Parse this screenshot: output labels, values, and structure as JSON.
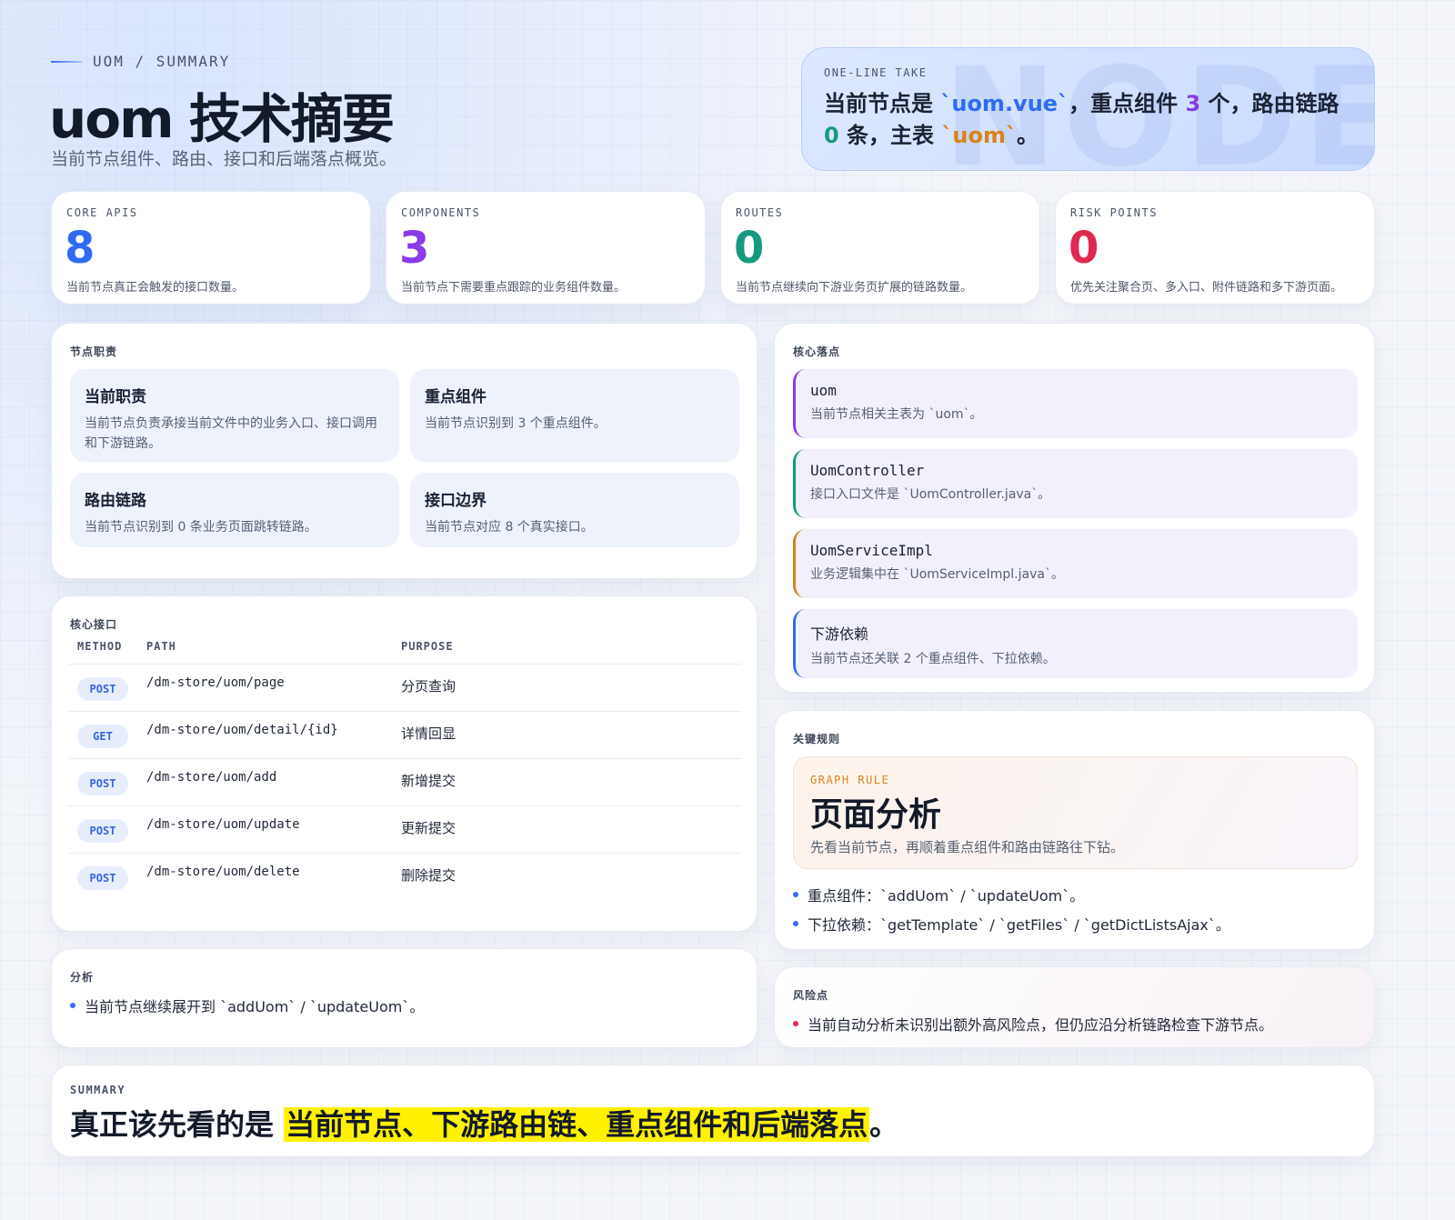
{
  "header": {
    "eyebrow": "UOM / SUMMARY",
    "title": "uom 技术摘要",
    "subtitle": "当前节点组件、路由、接口和后端落点概览。"
  },
  "take": {
    "kicker": "ONE-LINE TAKE",
    "watermark": "NODE",
    "p1": "当前节点是 ",
    "file": "`uom.vue`",
    "p2": "，重点组件 ",
    "components": "3",
    "p3": " 个，路由链路 ",
    "routes": "0",
    "p4": " 条，主表 ",
    "table": "`uom`",
    "p5": "。"
  },
  "stats": [
    {
      "label": "CORE APIS",
      "value": "8",
      "desc": "当前节点真正会触发的接口数量。",
      "color": "#2f6bf2"
    },
    {
      "label": "COMPONENTS",
      "value": "3",
      "desc": "当前节点下需要重点跟踪的业务组件数量。",
      "color": "#8a3ae6"
    },
    {
      "label": "ROUTES",
      "value": "0",
      "desc": "当前节点继续向下游业务页扩展的链路数量。",
      "color": "#159a80"
    },
    {
      "label": "RISK POINTS",
      "value": "0",
      "desc": "优先关注聚合页、多入口、附件链路和多下游页面。",
      "color": "#e0284f"
    }
  ],
  "responsibility": {
    "title": "节点职责",
    "tiles": [
      {
        "title": "当前职责",
        "body": "当前节点负责承接当前文件中的业务入口、接口调用和下游链路。"
      },
      {
        "title": "重点组件",
        "body": "当前节点识别到 3 个重点组件。"
      },
      {
        "title": "路由链路",
        "body": "当前节点识别到 0 条业务页面跳转链路。"
      },
      {
        "title": "接口边界",
        "body": "当前节点对应 8 个真实接口。"
      }
    ]
  },
  "landing": {
    "title": "核心落点",
    "items": [
      {
        "name": "uom",
        "desc": "当前节点相关主表为 `uom`。",
        "color": "#8a3ae6"
      },
      {
        "name": "UomController",
        "desc": "接口入口文件是 `UomController.java`。",
        "color": "#159a80"
      },
      {
        "name": "UomServiceImpl",
        "desc": "业务逻辑集中在 `UomServiceImpl.java`。",
        "color": "#d9821a"
      },
      {
        "name": "下游依赖",
        "desc": "当前节点还关联 2 个重点组件、下拉依赖。",
        "color": "#2f6bf2"
      }
    ]
  },
  "apis": {
    "title": "核心接口",
    "columns": [
      "METHOD",
      "PATH",
      "PURPOSE"
    ],
    "rows": [
      {
        "method": "POST",
        "path": "/dm-store/uom/page",
        "purpose": "分页查询"
      },
      {
        "method": "GET",
        "path": "/dm-store/uom/detail/{id}",
        "purpose": "详情回显"
      },
      {
        "method": "POST",
        "path": "/dm-store/uom/add",
        "purpose": "新增提交"
      },
      {
        "method": "POST",
        "path": "/dm-store/uom/update",
        "purpose": "更新提交"
      },
      {
        "method": "POST",
        "path": "/dm-store/uom/delete",
        "purpose": "删除提交"
      }
    ]
  },
  "rules": {
    "title": "关键规则",
    "kicker": "GRAPH RULE",
    "headline": "页面分析",
    "desc": "先看当前节点，再顺着重点组件和路由链路往下钻。",
    "bullets": [
      "重点组件：`addUom` / `updateUom`。",
      "下拉依赖：`getTemplate` / `getFiles` / `getDictListsAjax`。"
    ]
  },
  "analysis": {
    "title": "分析",
    "bullets": [
      "当前节点继续展开到 `addUom` / `updateUom`。"
    ]
  },
  "risk": {
    "title": "风险点",
    "bullets": [
      "当前自动分析未识别出额外高风险点，但仍应沿分析链路检查下游节点。"
    ]
  },
  "summary": {
    "kicker": "SUMMARY",
    "lead": "真正该先看的是 ",
    "highlight": "当前节点、下游路由链、重点组件和后端落点",
    "tail": "。"
  },
  "colors": {
    "accent": "#3b6cf6",
    "risk": "#e0284f",
    "highlight": "#fff200"
  }
}
